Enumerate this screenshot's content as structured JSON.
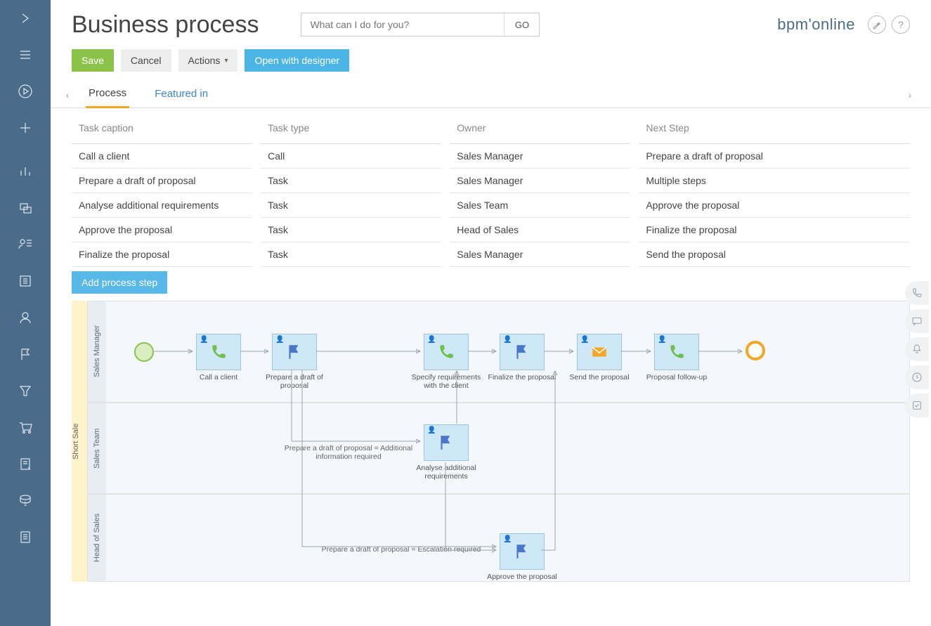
{
  "header": {
    "title": "Business process",
    "search_placeholder": "What can I do for you?",
    "go_label": "GO",
    "brand_prefix": "bpm",
    "brand_suffix": "online"
  },
  "actions": {
    "save": "Save",
    "cancel": "Cancel",
    "actions": "Actions",
    "open_designer": "Open with designer"
  },
  "tabs": {
    "process": "Process",
    "featured": "Featured in"
  },
  "table": {
    "headers": {
      "caption": "Task caption",
      "type": "Task type",
      "owner": "Owner",
      "next": "Next Step"
    },
    "rows": [
      {
        "caption": "Call a client",
        "type": "Call",
        "owner": "Sales Manager",
        "next": "Prepare a draft of proposal"
      },
      {
        "caption": "Prepare a draft of proposal",
        "type": "Task",
        "owner": "Sales Manager",
        "next": "Multiple steps"
      },
      {
        "caption": "Analyse additional requirements",
        "type": "Task",
        "owner": "Sales Team",
        "next": "Approve the proposal"
      },
      {
        "caption": "Approve the proposal",
        "type": "Task",
        "owner": "Head of Sales",
        "next": "Finalize the proposal"
      },
      {
        "caption": "Finalize the proposal",
        "type": "Task",
        "owner": "Sales Manager",
        "next": "Send the proposal"
      }
    ],
    "add_step": "Add process step"
  },
  "diagram": {
    "pool": "Short Sale",
    "lanes": {
      "l1": "Sales Manager",
      "l2": "Sales Team",
      "l3": "Head of Sales"
    },
    "nodes": {
      "n1": "Call a client",
      "n2": "Prepare a draft of proposal",
      "n3": "Specify requirements with the client",
      "n4": "Finalize the proposal",
      "n5": "Send the proposal",
      "n6": "Proposal follow-up",
      "n7": "Analyse additional requirements",
      "n8": "Approve the proposal"
    },
    "conds": {
      "c1": "Prepare a draft of proposal = Additional information required",
      "c2": "Prepare a draft of proposal = Escalation required"
    }
  }
}
